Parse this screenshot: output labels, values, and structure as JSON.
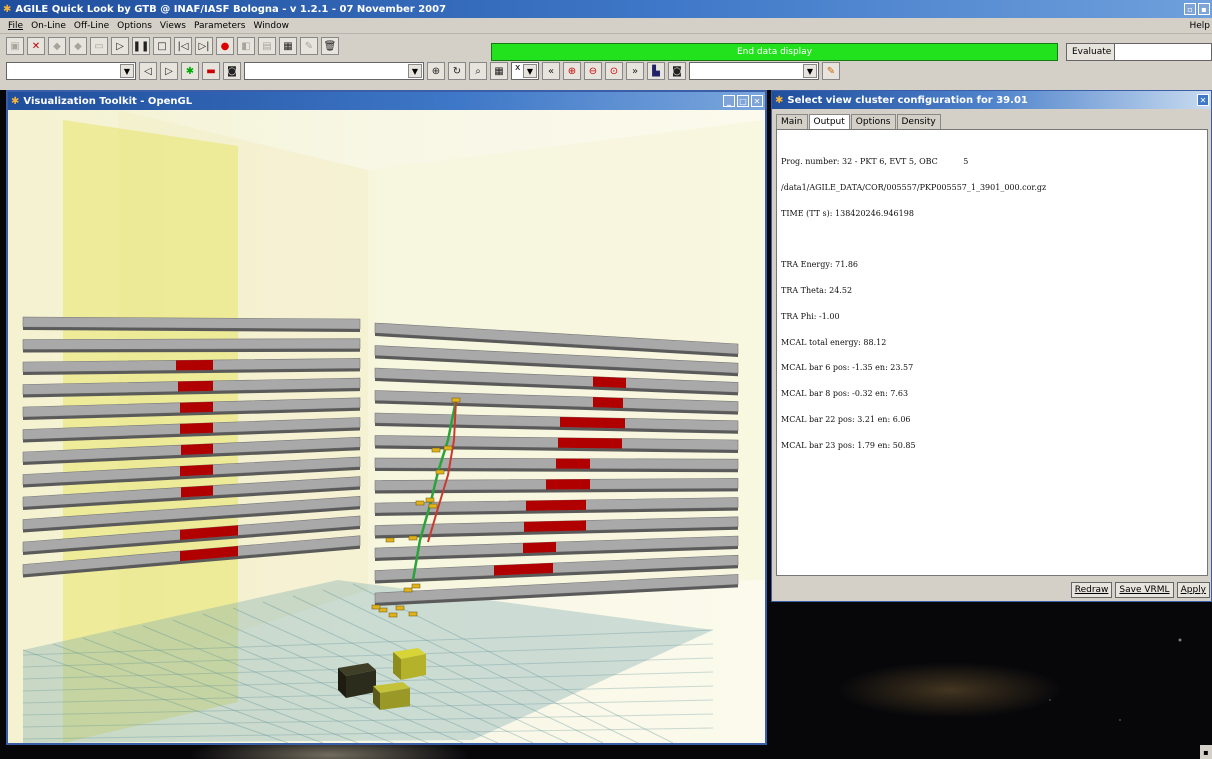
{
  "app": {
    "title": "AGILE Quick Look by GTB @ INAF/IASF Bologna - v 1.2.1 - 07 November 2007"
  },
  "menubar": {
    "items": [
      "File",
      "On-Line",
      "Off-Line",
      "Options",
      "Views",
      "Parameters",
      "Window"
    ],
    "help": "Help"
  },
  "toolbar": {
    "status_text": "End data display",
    "status_color": "#22e21e",
    "evaluate_label": "Evaluate",
    "evaluate_value": ""
  },
  "toolbar2": {
    "axis_select": "x"
  },
  "vtk": {
    "title": "Visualization Toolkit - OpenGL"
  },
  "cluster": {
    "title": "Select view cluster configuration for 39.01",
    "tabs": [
      "Main",
      "Output",
      "Options",
      "Density"
    ],
    "active_tab": "Output",
    "output_lines": [
      "Prog. number: 32 - PKT 6, EVT 5, OBC          5",
      "/data1/AGILE_DATA/COR/005557/PKP005557_1_3901_000.cor.gz",
      "TIME (TT s): 138420246.946198",
      "",
      "TRA Energy: 71.86",
      "TRA Theta: 24.52",
      "TRA Phi: -1.00",
      "MCAL total energy: 88.12",
      "MCAL bar 6 pos: -1.35 en: 23.57",
      "MCAL bar 8 pos: -0.32 en: 7.63",
      "MCAL bar 22 pos: 3.21 en: 6.06",
      "MCAL bar 23 pos: 1.79 en: 50.85"
    ],
    "buttons": {
      "redraw": "Redraw",
      "save_vrml": "Save VRML",
      "apply": "Apply"
    }
  },
  "colors": {
    "title_blue": "#1f4e9c",
    "hit_red": "#b00000",
    "bar_gray": "#a9a9a9",
    "track_green": "#2aa43a",
    "track_red": "#c83a30"
  }
}
